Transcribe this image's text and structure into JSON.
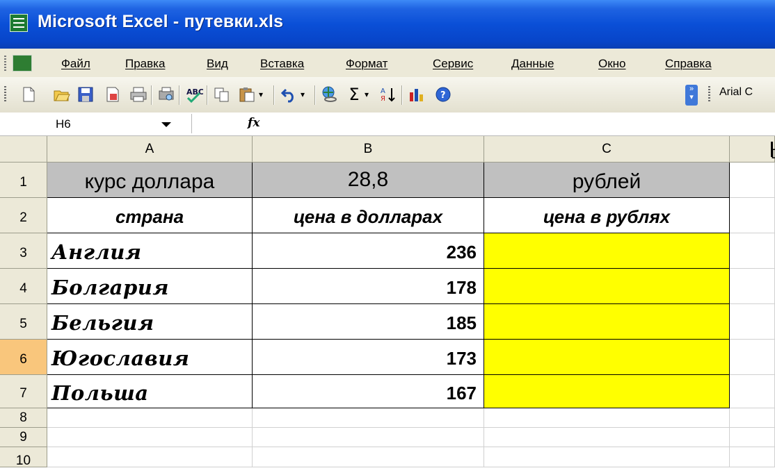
{
  "window": {
    "title": "Microsoft Excel - путевки.xls"
  },
  "menu": {
    "items": [
      "Файл",
      "Правка",
      "Вид",
      "Вставка",
      "Формат",
      "Сервис",
      "Данные",
      "Окно",
      "Справка"
    ]
  },
  "toolbar": {
    "buttons": [
      "new-icon",
      "open-icon",
      "save-icon",
      "permission-icon",
      "print-icon",
      "print-preview-icon",
      "spelling-icon",
      "copy-icon",
      "paste-icon",
      "undo-icon",
      "hyperlink-icon",
      "autosum-icon",
      "sort-ascending-icon",
      "chart-wizard-icon",
      "help-icon"
    ],
    "font_name": "Arial C"
  },
  "formula_bar": {
    "name_box": "H6",
    "fx_label": "fx",
    "formula": ""
  },
  "grid": {
    "columns": [
      "A",
      "B",
      "C",
      "D"
    ],
    "rows": [
      "1",
      "2",
      "3",
      "4",
      "5",
      "6",
      "7",
      "8",
      "9",
      "10"
    ],
    "selected_row": "6",
    "header_row": {
      "a": "курс доллара",
      "b": "28,8",
      "c": "рублей"
    },
    "subheader_row": {
      "a": "страна",
      "b": "цена в долларах",
      "c": "цена в рублях"
    },
    "data": [
      {
        "country": "Англия",
        "price": "236"
      },
      {
        "country": "Болгария",
        "price": "178"
      },
      {
        "country": "Бельгия",
        "price": "185"
      },
      {
        "country": "Югославия",
        "price": "173"
      },
      {
        "country": "Польша",
        "price": "167"
      }
    ]
  },
  "colors": {
    "title_bar": "#0a4fd7",
    "highlight_fill": "#ffff00",
    "header_fill": "#c0c0c0",
    "selected_row_header": "#f9c67c"
  }
}
